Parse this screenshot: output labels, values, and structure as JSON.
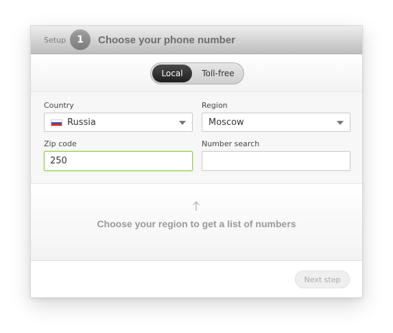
{
  "header": {
    "setup_label": "Setup",
    "step_number": "1",
    "title": "Choose your phone number"
  },
  "number_type_toggle": {
    "options": [
      "Local",
      "Toll-free"
    ],
    "selected": "Local"
  },
  "form": {
    "country": {
      "label": "Country",
      "value": "Russia",
      "flag_icon": "russia-flag-icon"
    },
    "region": {
      "label": "Region",
      "value": "Moscow"
    },
    "zip_code": {
      "label": "Zip code",
      "value": "250"
    },
    "number_search": {
      "label": "Number search",
      "value": ""
    }
  },
  "results": {
    "icon": "arrow-up-icon",
    "hint": "Choose your region to get a list of numbers"
  },
  "footer": {
    "next_label": "Next step",
    "next_enabled": false
  },
  "colors": {
    "focus_border": "#92cc3b",
    "toggle_active_bg": "#2b2b2b",
    "hint_text": "#999999"
  }
}
